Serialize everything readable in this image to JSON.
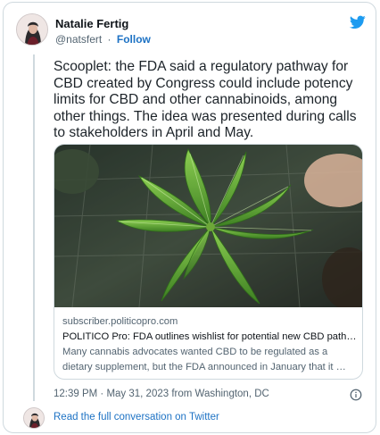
{
  "author": {
    "name": "Natalie Fertig",
    "handle": "@natsfert",
    "separator": "·",
    "follow_label": "Follow"
  },
  "tweet": {
    "text": "Scooplet: the FDA said a regulatory pathway for CBD created by Congress could include potency limits for CBD and other cannabinoids, among other things. The idea was presented during calls to stakeholders in April and May."
  },
  "link_card": {
    "domain": "subscriber.politicopro.com",
    "title": "POLITICO Pro: FDA outlines wishlist for potential new CBD path…",
    "description": "Many cannabis advocates wanted CBD to be regulated as a dietary supplement, but the FDA announced in January that it …"
  },
  "meta": {
    "timestamp": "12:39 PM · May 31, 2023 from Washington, DC"
  },
  "footer": {
    "link_label": "Read the full conversation on Twitter"
  },
  "icons": {
    "brand": "twitter-bird-icon",
    "info": "info-icon"
  },
  "colors": {
    "brand_blue": "#1d9bf0",
    "link_blue": "#1d72c4",
    "secondary_text": "#536471",
    "border": "#cfd9de"
  }
}
